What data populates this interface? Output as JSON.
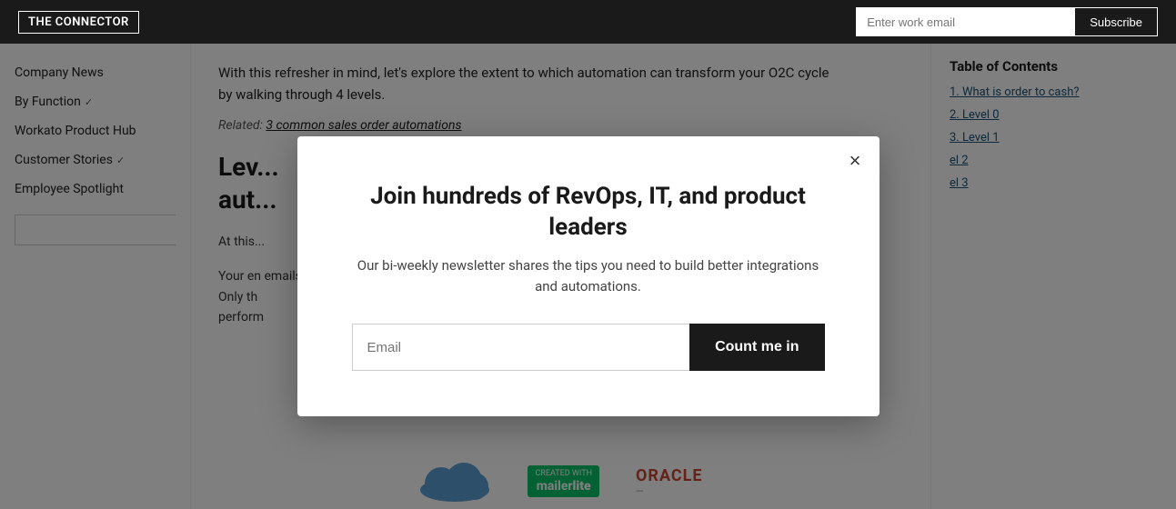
{
  "header": {
    "logo": "THE CONNECTOR",
    "email_placeholder": "Enter work email",
    "subscribe_label": "Subscribe"
  },
  "sidebar": {
    "items": [
      {
        "id": "company-news",
        "label": "Company News",
        "hasChevron": false
      },
      {
        "id": "by-function",
        "label": "By Function",
        "hasChevron": true
      },
      {
        "id": "workato-product-hub",
        "label": "Workato Product Hub",
        "hasChevron": false
      },
      {
        "id": "customer-stories",
        "label": "Customer Stories",
        "hasChevron": true
      },
      {
        "id": "employee-spotlight",
        "label": "Employee Spotlight",
        "hasChevron": false
      }
    ],
    "search_placeholder": ""
  },
  "main": {
    "intro_text": "With this refresher in mind, let's explore the extent to which automation can transform your O2C cycle by walking through 4 levels.",
    "related_label": "Related:",
    "related_link_text": "3 common sales order automations",
    "heading_partial": "Lev",
    "heading_partial2": "aut",
    "body_partial1": "At this",
    "body_partial2": "Your en emails, Only th perform"
  },
  "toc": {
    "title": "Table of Contents",
    "items": [
      {
        "number": "1.",
        "label": "What is order to cash?"
      },
      {
        "number": "2.",
        "label": "Level 0"
      },
      {
        "number": "3.",
        "label": "Level 1"
      },
      {
        "label": "el 2"
      },
      {
        "label": "el 3"
      }
    ]
  },
  "modal": {
    "title": "Join hundreds of RevOps, IT, and product leaders",
    "subtitle": "Our bi-weekly newsletter shares the tips you need to build better integrations and automations.",
    "email_placeholder": "Email",
    "submit_label": "Count me in",
    "close_label": "×"
  },
  "bottom": {
    "mailerlite_created": "CREATED WITH",
    "mailerlite_name": "mailer",
    "mailerlite_lite": "lite",
    "oracle_label": "ORACLE"
  }
}
